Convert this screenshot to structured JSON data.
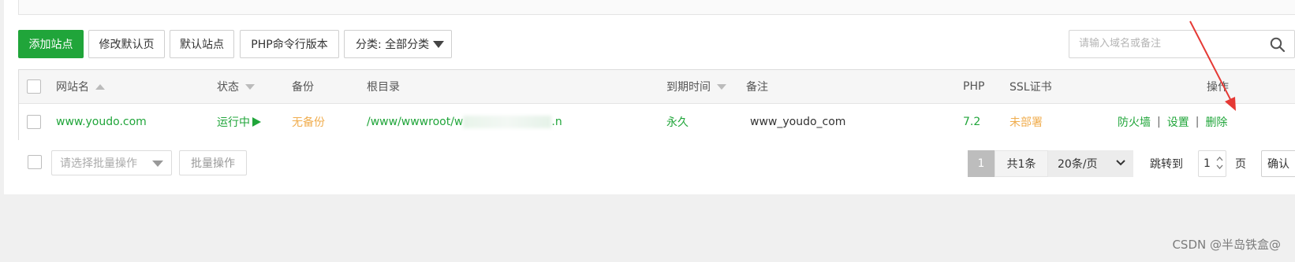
{
  "toolbar": {
    "add_site": "添加站点",
    "edit_default_page": "修改默认页",
    "default_site": "默认站点",
    "php_cli_version": "PHP命令行版本",
    "category_select": "分类: 全部分类",
    "search_placeholder": "请输入域名或备注"
  },
  "table": {
    "headers": {
      "site_name": "网站名",
      "status": "状态",
      "backup": "备份",
      "root_dir": "根目录",
      "expire": "到期时间",
      "remark": "备注",
      "php": "PHP",
      "ssl": "SSL证书",
      "actions": "操作"
    },
    "rows": [
      {
        "site_name": "www.youdo.com",
        "status": "运行中",
        "status_icon": "play-triangle",
        "backup": "无备份",
        "root_dir_prefix": "/www/wwwroot/w",
        "root_dir_suffix": ".n",
        "expire": "永久",
        "remark": "www_youdo_com",
        "php": "7.2",
        "ssl": "未部署",
        "actions": [
          "防火墙",
          "设置",
          "删除"
        ]
      }
    ]
  },
  "footer": {
    "batch_select_placeholder": "请选择批量操作",
    "batch_button": "批量操作",
    "current_page": "1",
    "total": "共1条",
    "per_page": "20条/页",
    "jump_to": "跳转到",
    "jump_value": "1",
    "page_unit": "页",
    "confirm": "确认"
  },
  "watermark": "CSDN @半岛铁盒@",
  "colors": {
    "primary_green": "#20a53a",
    "warning_orange": "#f0ad4e",
    "annotation_red": "#e53935"
  }
}
